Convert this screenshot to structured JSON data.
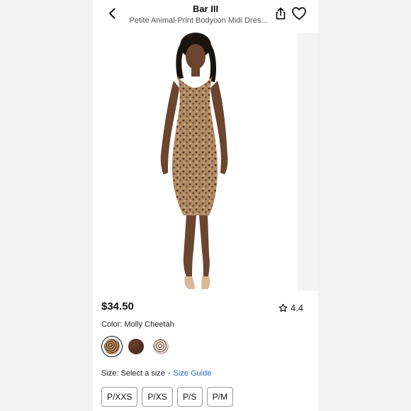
{
  "header": {
    "brand": "Bar III",
    "subtitle": "Petite Animal-Print Bodycon Midi Dres..."
  },
  "product": {
    "price": "$34.50",
    "rating": "4.4",
    "color_label": "Color: Molly Cheetah",
    "swatches": [
      {
        "name": "cheetah-tan",
        "color": "#b38a5c",
        "selected": true
      },
      {
        "name": "dark-brown",
        "color": "#4a2e22",
        "selected": false
      },
      {
        "name": "leopard-white",
        "color": "#d9c9bd",
        "selected": false
      }
    ],
    "size_label": "Size: Select a size",
    "separator": "·",
    "size_guide": "Size Guide",
    "sizes": [
      "P/XXS",
      "P/XS",
      "P/S",
      "P/M"
    ]
  },
  "colors": {
    "accent_link": "#1e6fb8",
    "dress": "#a88560",
    "skin": "#6b4530",
    "shoes": "#d8b894"
  }
}
